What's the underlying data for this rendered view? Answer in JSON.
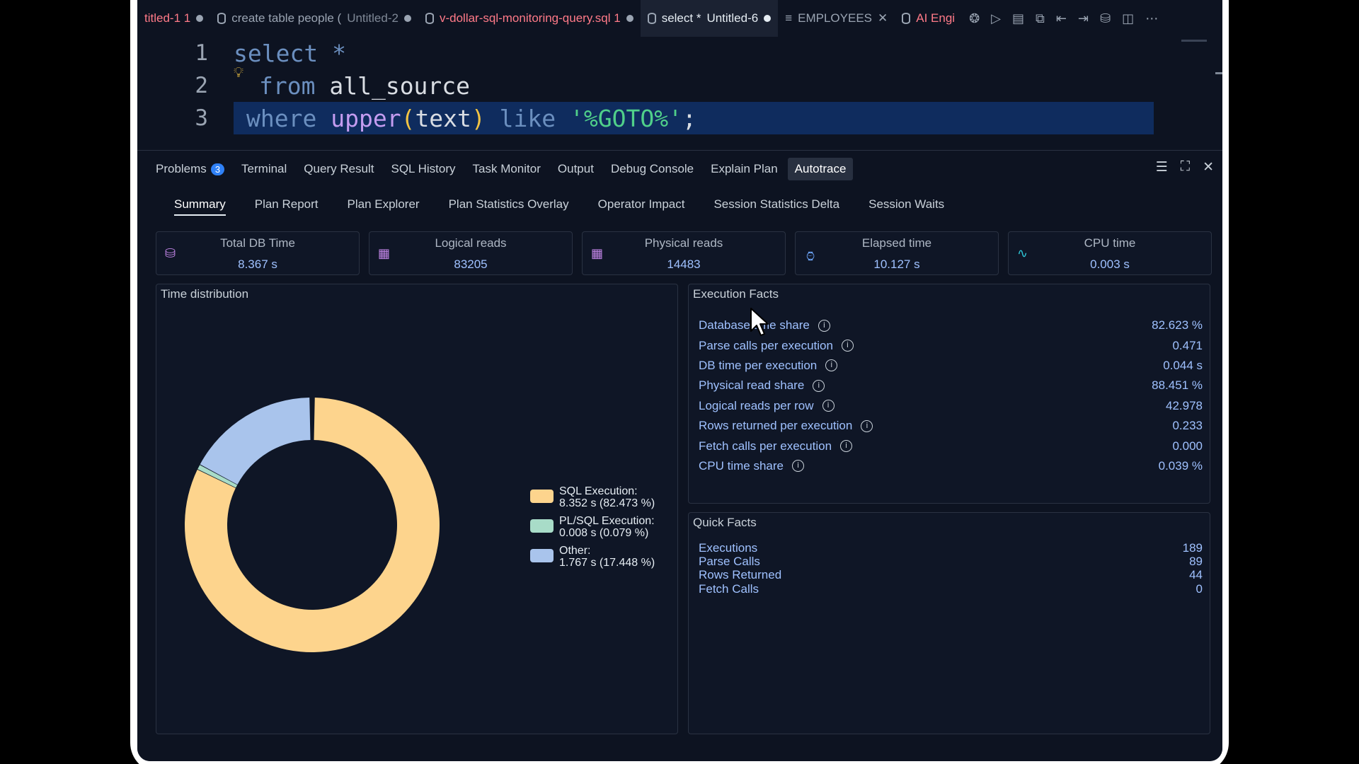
{
  "tabs": [
    {
      "label": "titled-1 1",
      "style": "red",
      "modified": true
    },
    {
      "label": "create table people (",
      "sub": "Untitled-2",
      "modified": true
    },
    {
      "label": "v-dollar-sql-monitoring-query.sql 1",
      "style": "red",
      "modified": true
    },
    {
      "label": "select *",
      "sub": "Untitled-6",
      "modified": true,
      "active": true
    },
    {
      "label": "EMPLOYEES",
      "closable": true
    },
    {
      "label": "AI Engi",
      "style": "red"
    }
  ],
  "editor": {
    "lines": [
      {
        "num": "1",
        "tokens": [
          [
            "kw",
            "select"
          ],
          [
            "id",
            " "
          ],
          [
            "kw",
            "*"
          ]
        ]
      },
      {
        "num": "2",
        "tokens": [
          [
            "kw",
            "from"
          ],
          [
            "id",
            " all_source"
          ]
        ]
      },
      {
        "num": "3",
        "tokens": [
          [
            "kw",
            "where"
          ],
          [
            "id",
            " "
          ],
          [
            "fn",
            "upper"
          ],
          [
            "paren",
            "("
          ],
          [
            "id",
            "text"
          ],
          [
            "paren",
            ")"
          ],
          [
            "id",
            " "
          ],
          [
            "kw",
            "like"
          ],
          [
            "id",
            " "
          ],
          [
            "str",
            "'%GOTO%'"
          ],
          [
            "id",
            ";"
          ]
        ]
      }
    ]
  },
  "panel": {
    "tabs": [
      "Problems",
      "Terminal",
      "Query Result",
      "SQL History",
      "Task Monitor",
      "Output",
      "Debug Console",
      "Explain Plan",
      "Autotrace"
    ],
    "problems_count": "3",
    "active_tab": "Autotrace"
  },
  "subtabs": [
    "Summary",
    "Plan Report",
    "Plan Explorer",
    "Plan Statistics Overlay",
    "Operator Impact",
    "Session Statistics Delta",
    "Session Waits"
  ],
  "metrics": [
    {
      "label": "Total DB Time",
      "value": "8.367 s",
      "icon": "database-icon"
    },
    {
      "label": "Logical reads",
      "value": "83205",
      "icon": "grid-icon"
    },
    {
      "label": "Physical reads",
      "value": "14483",
      "icon": "grid-icon"
    },
    {
      "label": "Elapsed time",
      "value": "10.127 s",
      "icon": "stopwatch-icon"
    },
    {
      "label": "CPU time",
      "value": "0.003 s",
      "icon": "activity-icon"
    }
  ],
  "time_distribution": {
    "title": "Time distribution",
    "legend": [
      {
        "name": "SQL Execution:",
        "detail": "8.352 s (82.473 %)",
        "color": "#fdd48d"
      },
      {
        "name": "PL/SQL Execution:",
        "detail": "0.008 s (0.079 %)",
        "color": "#a8dcc8"
      },
      {
        "name": "Other:",
        "detail": "1.767 s (17.448 %)",
        "color": "#a9c4ec"
      }
    ]
  },
  "chart_data": {
    "type": "pie",
    "categories": [
      "SQL Execution",
      "PL/SQL Execution",
      "Other"
    ],
    "values": [
      82.473,
      0.079,
      17.448
    ],
    "colors": [
      "#fdd48d",
      "#a8dcc8",
      "#a9c4ec"
    ]
  },
  "execution_facts": {
    "title": "Execution Facts",
    "rows": [
      {
        "label": "Database time share",
        "value": "82.623 %"
      },
      {
        "label": "Parse calls per execution",
        "value": "0.471"
      },
      {
        "label": "DB time per execution",
        "value": "0.044 s"
      },
      {
        "label": "Physical read share",
        "value": "88.451 %"
      },
      {
        "label": "Logical reads per row",
        "value": "42.978"
      },
      {
        "label": "Rows returned per execution",
        "value": "0.233"
      },
      {
        "label": "Fetch calls per execution",
        "value": "0.000"
      },
      {
        "label": "CPU time share",
        "value": "0.039 %"
      }
    ]
  },
  "quick_facts": {
    "title": "Quick Facts",
    "rows": [
      {
        "label": "Executions",
        "value": "189"
      },
      {
        "label": "Parse Calls",
        "value": "89"
      },
      {
        "label": "Rows Returned",
        "value": "44"
      },
      {
        "label": "Fetch Calls",
        "value": "0"
      }
    ]
  }
}
